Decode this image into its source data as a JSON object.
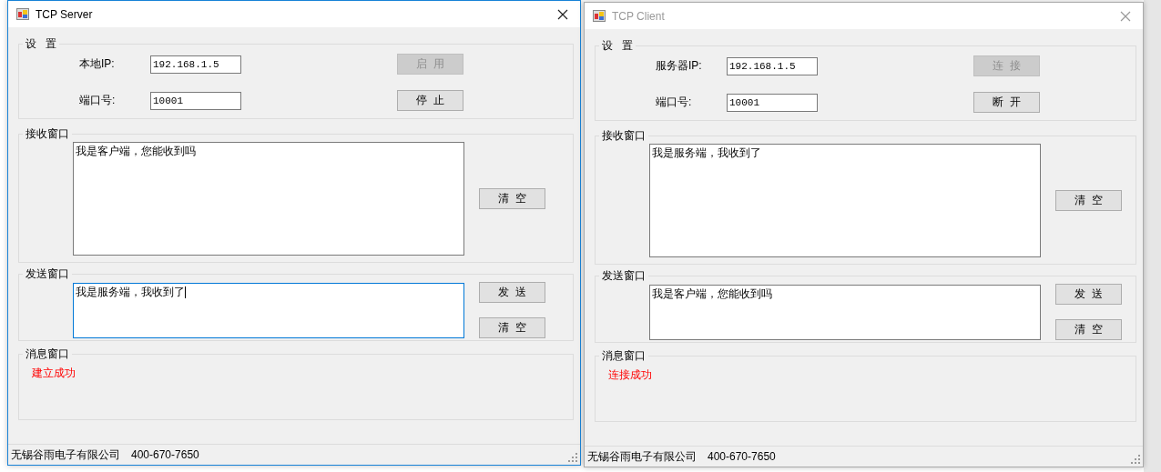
{
  "windows": [
    {
      "title": "TCP Server",
      "active": true,
      "settings": {
        "title": "设   置",
        "fields": [
          {
            "label": "本地IP:",
            "value": "192.168.1.5"
          },
          {
            "label": "端口号:",
            "value": "10001"
          }
        ],
        "buttons": [
          {
            "label": "启  用",
            "disabled": true
          },
          {
            "label": "停  止",
            "disabled": false
          }
        ]
      },
      "receive": {
        "title": "接收窗口",
        "text": "我是客户端，您能收到吗",
        "buttons": [
          {
            "label": "清  空",
            "disabled": false
          }
        ]
      },
      "send": {
        "title": "发送窗口",
        "text": "我是服务端，我收到了",
        "focused": true,
        "buttons": [
          {
            "label": "发  送",
            "disabled": false
          },
          {
            "label": "清  空",
            "disabled": false
          }
        ]
      },
      "messages": {
        "title": "消息窗口",
        "text": "建立成功"
      },
      "status_bar": [
        "无锡谷雨电子有限公司",
        "400-670-7650"
      ]
    },
    {
      "title": "TCP Client",
      "active": false,
      "settings": {
        "title": "设   置",
        "fields": [
          {
            "label": "服务器IP:",
            "value": "192.168.1.5"
          },
          {
            "label": "端口号:",
            "value": "10001"
          }
        ],
        "buttons": [
          {
            "label": "连  接",
            "disabled": true
          },
          {
            "label": "断  开",
            "disabled": false
          }
        ]
      },
      "receive": {
        "title": "接收窗口",
        "text": "我是服务端，我收到了",
        "buttons": [
          {
            "label": "清  空",
            "disabled": false
          }
        ]
      },
      "send": {
        "title": "发送窗口",
        "text": "我是客户端，您能收到吗",
        "focused": false,
        "buttons": [
          {
            "label": "发  送",
            "disabled": false
          },
          {
            "label": "清  空",
            "disabled": false
          }
        ]
      },
      "messages": {
        "title": "消息窗口",
        "text": "连接成功"
      },
      "status_bar": [
        "无锡谷雨电子有限公司",
        "400-670-7650"
      ]
    }
  ]
}
